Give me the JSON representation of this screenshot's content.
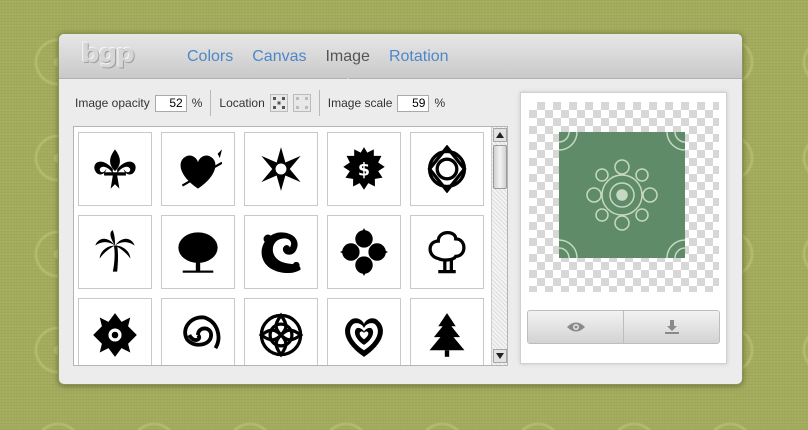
{
  "app": {
    "logo_text": "bgp"
  },
  "tabs": [
    {
      "label": "Colors"
    },
    {
      "label": "Canvas"
    },
    {
      "label": "Image",
      "active": true
    },
    {
      "label": "Rotation"
    }
  ],
  "controls": {
    "opacity_label": "Image opacity",
    "opacity_value": "52",
    "opacity_unit": "%",
    "location_label": "Location",
    "scale_label": "Image scale",
    "scale_value": "59",
    "scale_unit": "%"
  },
  "images": [
    {
      "icon": "fleur-de-lis-icon"
    },
    {
      "icon": "heart-arrow-icon"
    },
    {
      "icon": "star-burst-ornament-icon"
    },
    {
      "icon": "dollar-seal-icon"
    },
    {
      "icon": "celtic-knot-icon"
    },
    {
      "icon": "palm-tree-icon"
    },
    {
      "icon": "bare-tree-icon"
    },
    {
      "icon": "swirl-ornament-icon"
    },
    {
      "icon": "quatrefoil-flower-icon"
    },
    {
      "icon": "cartoon-tree-icon"
    },
    {
      "icon": "damask-ornament-icon"
    },
    {
      "icon": "spiral-icon"
    },
    {
      "icon": "round-filigree-icon"
    },
    {
      "icon": "layered-heart-icon"
    },
    {
      "icon": "pine-tree-icon"
    }
  ],
  "preview": {
    "tile_color": "#5f8b68",
    "buttons": [
      {
        "icon": "eye-icon"
      },
      {
        "icon": "download-icon"
      }
    ]
  },
  "colors": {
    "background": "#a3ab5c",
    "tab_link": "#4d87c9",
    "tab_active": "#555555"
  }
}
